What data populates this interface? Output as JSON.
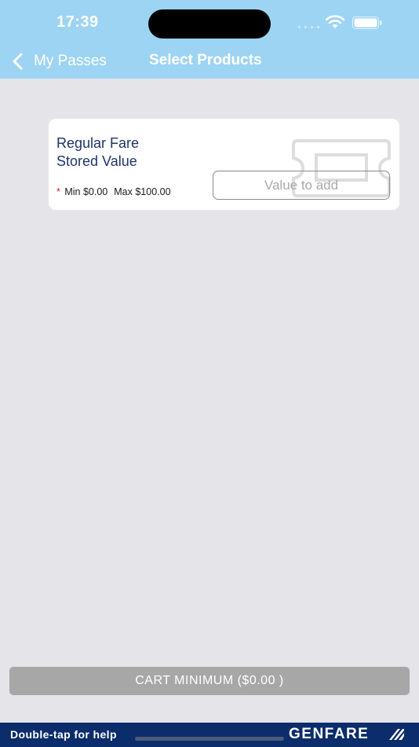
{
  "status_bar": {
    "time": "17:39"
  },
  "nav": {
    "back_label": "My Passes",
    "title": "Select Products"
  },
  "product_card": {
    "name_line1": "Regular Fare",
    "name_line2": "Stored Value",
    "required_marker": "*",
    "min_label": "Min $0.00",
    "max_label": "Max $100.00",
    "value_input_value": "",
    "value_input_placeholder": "Value to add",
    "icon": "ticket-icon"
  },
  "cart_button": {
    "label": "CART MINIMUM ($0.00 )"
  },
  "footer": {
    "help_text": "Double-tap for help",
    "brand": "GENFARE"
  },
  "colors": {
    "header_bg": "#9dd4f3",
    "page_bg": "#e5e4e9",
    "product_text": "#1e3469",
    "cart_button_bg": "#a7a7a7",
    "footer_bg": "#0c2d6b",
    "required_marker": "#d32020"
  }
}
